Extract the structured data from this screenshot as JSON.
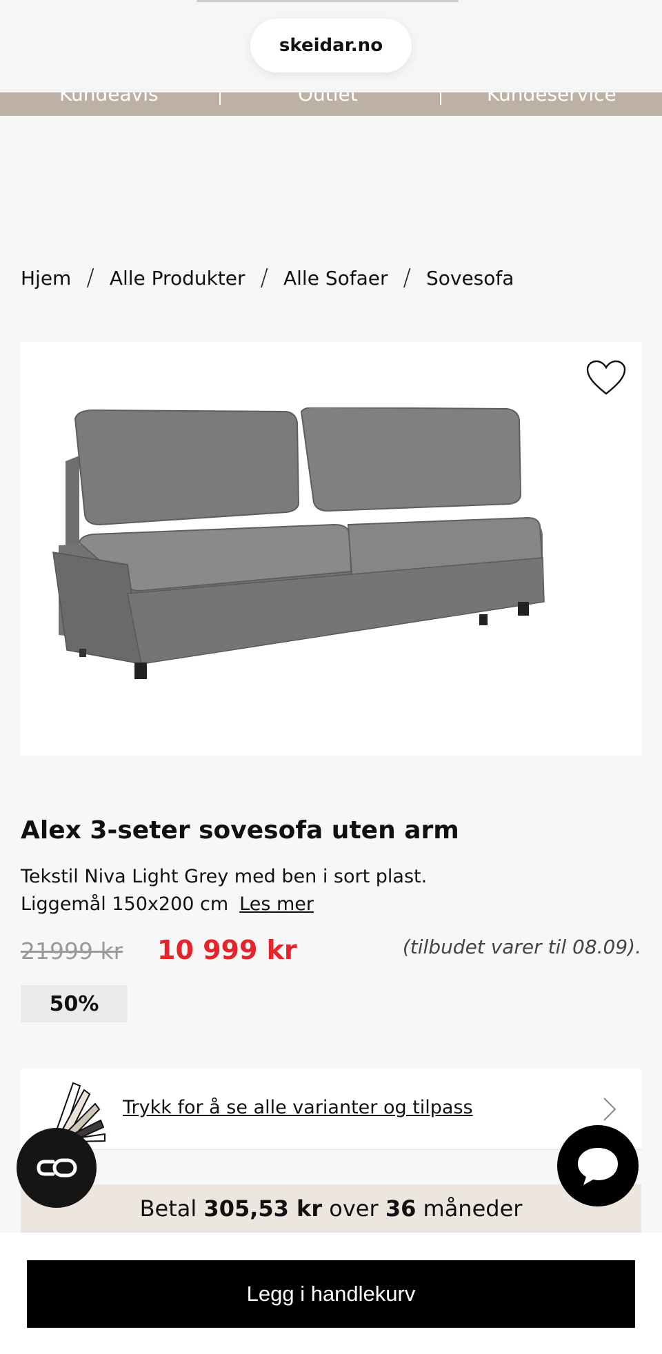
{
  "browser": {
    "url": "skeidar.no"
  },
  "top_nav": {
    "items": [
      "Kundeavis",
      "Outlet",
      "Kundeservice"
    ]
  },
  "breadcrumb": {
    "items": [
      "Hjem",
      "Alle Produkter",
      "Alle Sofaer",
      "Sovesofa"
    ],
    "separator": "/"
  },
  "product": {
    "title": "Alex 3-seter sovesofa uten arm",
    "description_line1": "Tekstil Niva Light Grey med ben i sort plast.",
    "description_line2": "Liggemål 150x200 cm",
    "read_more": "Les mer",
    "old_price": "21999 kr",
    "new_price": "10 999 kr",
    "offer_note": "(tilbudet varer til 08.09).",
    "discount": "50%",
    "favorite_icon": "heart-outline-icon"
  },
  "variants": {
    "link_text": "Trykk for å se alle varianter og tilpass",
    "icon": "fabric-swatch-icon"
  },
  "installment": {
    "prefix": "Betal",
    "amount": "305,53 kr",
    "middle": "over",
    "months": "36",
    "suffix": "måneder"
  },
  "floating": {
    "left_icon": "co-logo-icon",
    "right_icon": "chat-bubble-icon"
  },
  "cart": {
    "button_label": "Legg i handlekurv"
  },
  "colors": {
    "price_red": "#e4232a",
    "accent_beige": "#bdb0a4",
    "pay_bg": "#ece6de"
  }
}
